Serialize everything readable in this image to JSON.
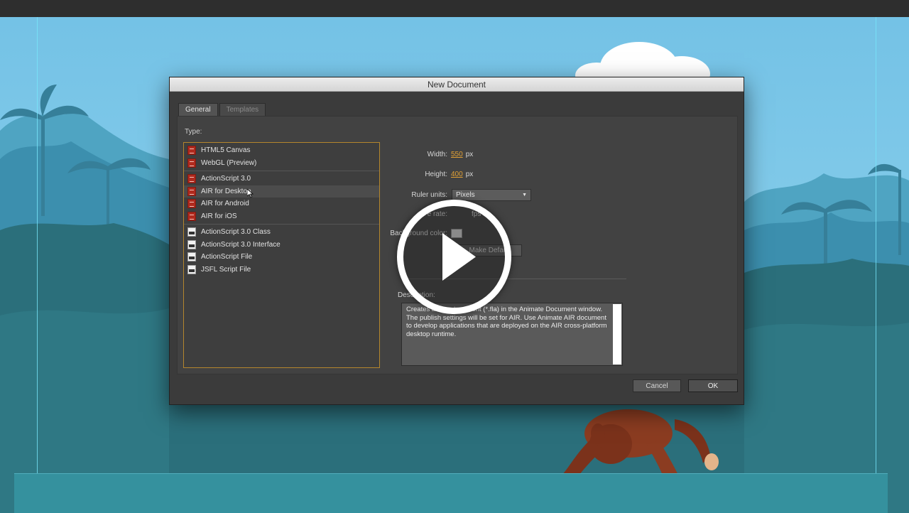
{
  "dialog": {
    "title": "New Document",
    "tabs": [
      {
        "label": "General",
        "active": true
      },
      {
        "label": "Templates",
        "active": false
      }
    ],
    "type_label": "Type:",
    "type_groups": [
      [
        {
          "label": "HTML5 Canvas",
          "icon": "fla-file-icon"
        },
        {
          "label": "WebGL (Preview)",
          "icon": "fla-file-icon"
        }
      ],
      [
        {
          "label": "ActionScript 3.0",
          "icon": "fla-file-icon"
        },
        {
          "label": "AIR for Desktop",
          "icon": "fla-file-icon",
          "selected": true
        },
        {
          "label": "AIR for Android",
          "icon": "fla-file-icon"
        },
        {
          "label": "AIR for iOS",
          "icon": "fla-file-icon"
        }
      ],
      [
        {
          "label": "ActionScript 3.0 Class",
          "icon": "script-file-icon"
        },
        {
          "label": "ActionScript 3.0 Interface",
          "icon": "script-file-icon"
        },
        {
          "label": "ActionScript File",
          "icon": "script-file-icon"
        },
        {
          "label": "JSFL Script File",
          "icon": "script-file-icon"
        }
      ]
    ],
    "width_label": "Width:",
    "width_value": "550",
    "width_unit": "px",
    "height_label": "Height:",
    "height_value": "400",
    "height_unit": "px",
    "ruler_label": "Ruler units:",
    "ruler_value": "Pixels",
    "frame_rate_label": "e rate:",
    "frame_rate_unit": "fps",
    "bg_label": "Background color:",
    "bg_color": "#d7d7d7",
    "make_default": "Make Default",
    "description_label": "Description:",
    "description": "Creates a new document (*.fla) in the Animate Document window. The publish settings will be set for AIR. Use Animate AIR document to develop applications that are deployed on the AIR cross-platform desktop runtime.",
    "cancel": "Cancel",
    "ok": "OK"
  },
  "colors": {
    "accent": "#e1a034",
    "list_border": "#b4862d",
    "sky": "#7cc6e8",
    "jungle": "#2a6e79"
  },
  "overlay": {
    "icon": "play-icon"
  }
}
